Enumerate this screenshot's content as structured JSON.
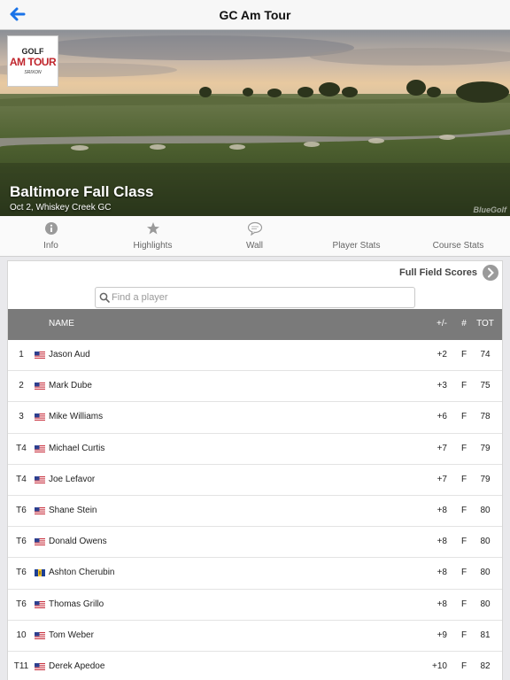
{
  "nav": {
    "title": "GC Am Tour",
    "back_icon": "back-arrow-icon",
    "accent": "#1a73e8"
  },
  "hero": {
    "logo": {
      "line1": "GOLF",
      "line2": "AM TOUR",
      "line3": "SRIXON"
    },
    "title": "Baltimore Fall Class",
    "subtitle": "Oct 2, Whiskey Creek GC",
    "watermark": "BlueGolf"
  },
  "tabs": [
    {
      "label": "Info",
      "icon": "info-icon"
    },
    {
      "label": "Highlights",
      "icon": "star-icon"
    },
    {
      "label": "Wall",
      "icon": "speech-bubble-icon"
    },
    {
      "label": "Player Stats",
      "icon": ""
    },
    {
      "label": "Course Stats",
      "icon": ""
    }
  ],
  "leaderboard": {
    "full_field_label": "Full Field Scores",
    "search_placeholder": "Find a player",
    "headers": {
      "name": "NAME",
      "plus_minus": "+/-",
      "thru": "#",
      "total": "TOT"
    },
    "rows": [
      {
        "pos": "1",
        "flag": "us",
        "name": "Jason Aud",
        "plus_minus": "+2",
        "thru": "F",
        "total": "74"
      },
      {
        "pos": "2",
        "flag": "us",
        "name": "Mark Dube",
        "plus_minus": "+3",
        "thru": "F",
        "total": "75"
      },
      {
        "pos": "3",
        "flag": "us",
        "name": "Mike Williams",
        "plus_minus": "+6",
        "thru": "F",
        "total": "78"
      },
      {
        "pos": "T4",
        "flag": "us",
        "name": "Michael Curtis",
        "plus_minus": "+7",
        "thru": "F",
        "total": "79"
      },
      {
        "pos": "T4",
        "flag": "us",
        "name": "Joe Lefavor",
        "plus_minus": "+7",
        "thru": "F",
        "total": "79"
      },
      {
        "pos": "T6",
        "flag": "us",
        "name": "Shane Stein",
        "plus_minus": "+8",
        "thru": "F",
        "total": "80"
      },
      {
        "pos": "T6",
        "flag": "us",
        "name": "Donald Owens",
        "plus_minus": "+8",
        "thru": "F",
        "total": "80"
      },
      {
        "pos": "T6",
        "flag": "bb",
        "name": "Ashton Cherubin",
        "plus_minus": "+8",
        "thru": "F",
        "total": "80"
      },
      {
        "pos": "T6",
        "flag": "us",
        "name": "Thomas Grillo",
        "plus_minus": "+8",
        "thru": "F",
        "total": "80"
      },
      {
        "pos": "10",
        "flag": "us",
        "name": "Tom Weber",
        "plus_minus": "+9",
        "thru": "F",
        "total": "81"
      },
      {
        "pos": "T11",
        "flag": "us",
        "name": "Derek Apedoe",
        "plus_minus": "+10",
        "thru": "F",
        "total": "82"
      }
    ]
  }
}
